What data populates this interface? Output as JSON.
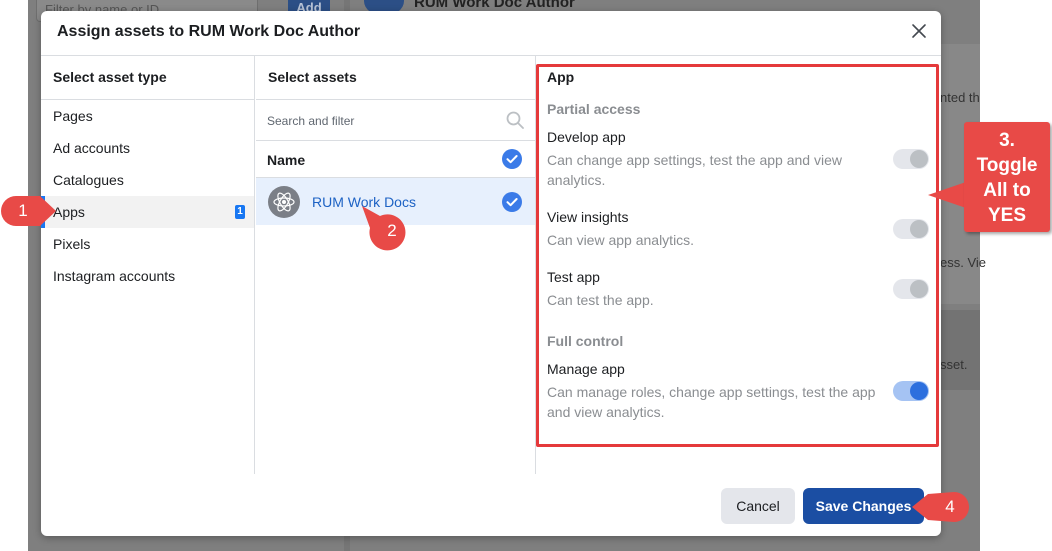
{
  "background": {
    "filter_placeholder": "Filter by name or ID",
    "add_label": "Add",
    "title": "RUM Work Doc Author",
    "side_text_1": "nted th",
    "side_text_2": "ess. Vie",
    "side_text_3": "sset."
  },
  "modal": {
    "title": "Assign assets to RUM Work Doc Author",
    "close_icon": "close-icon"
  },
  "asset_types": {
    "header": "Select asset type",
    "items": [
      {
        "label": "Pages"
      },
      {
        "label": "Ad accounts"
      },
      {
        "label": "Catalogues"
      },
      {
        "label": "Apps",
        "badge": "1",
        "selected": true
      },
      {
        "label": "Pixels"
      },
      {
        "label": "Instagram accounts"
      }
    ]
  },
  "assets": {
    "header": "Select assets",
    "search_placeholder": "Search and filter",
    "column_name": "Name",
    "items": [
      {
        "name": "RUM Work Docs",
        "selected": true,
        "icon": "atom-icon"
      }
    ]
  },
  "permissions": {
    "section_title": "App",
    "groups": [
      {
        "label": "Partial access",
        "items": [
          {
            "title": "Develop app",
            "description": "Can change app settings, test the app and view analytics.",
            "enabled": false
          },
          {
            "title": "View insights",
            "description": "Can view app analytics.",
            "enabled": false
          },
          {
            "title": "Test app",
            "description": "Can test the app.",
            "enabled": false
          }
        ]
      },
      {
        "label": "Full control",
        "items": [
          {
            "title": "Manage app",
            "description": "Can manage roles, change app settings, test the app and view analytics.",
            "enabled": true
          }
        ]
      }
    ]
  },
  "footer": {
    "cancel_label": "Cancel",
    "save_label": "Save Changes"
  },
  "annotations": {
    "step1": "1",
    "step2": "2",
    "step3": "3.\nToggle\nAll to\nYES",
    "step4": "4",
    "color": "#e84a47"
  }
}
